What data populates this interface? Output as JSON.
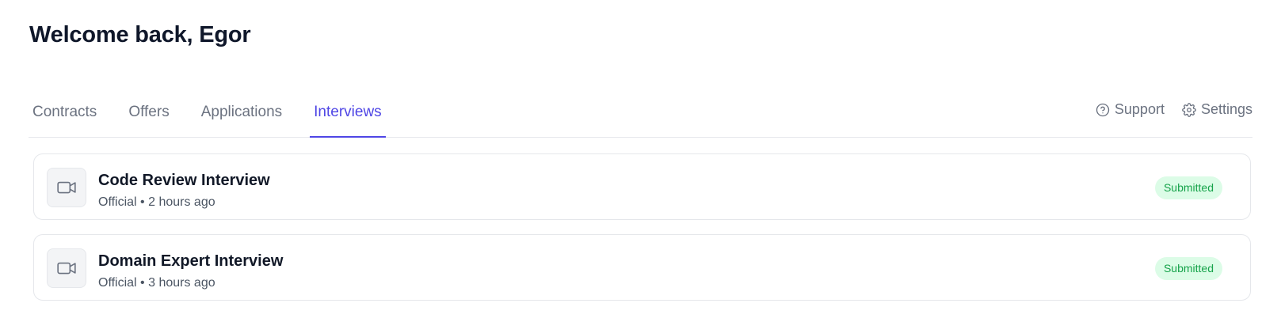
{
  "header": {
    "title": "Welcome back, Egor"
  },
  "tabs": [
    {
      "label": "Contracts",
      "active": false
    },
    {
      "label": "Offers",
      "active": false
    },
    {
      "label": "Applications",
      "active": false
    },
    {
      "label": "Interviews",
      "active": true
    }
  ],
  "utility_links": {
    "support": {
      "label": "Support",
      "icon": "help-circle-icon"
    },
    "settings": {
      "label": "Settings",
      "icon": "gear-icon"
    }
  },
  "interviews": [
    {
      "title": "Code Review Interview",
      "meta": "Official • 2 hours ago",
      "status": "Submitted",
      "icon": "video-camera-icon"
    },
    {
      "title": "Domain Expert Interview",
      "meta": "Official • 3 hours ago",
      "status": "Submitted",
      "icon": "video-camera-icon"
    }
  ],
  "colors": {
    "accent": "#4f46e5",
    "tab_inactive": "#6b7280",
    "badge_bg": "#dcfce7",
    "badge_text": "#16a34a",
    "border": "#e5e7eb"
  }
}
